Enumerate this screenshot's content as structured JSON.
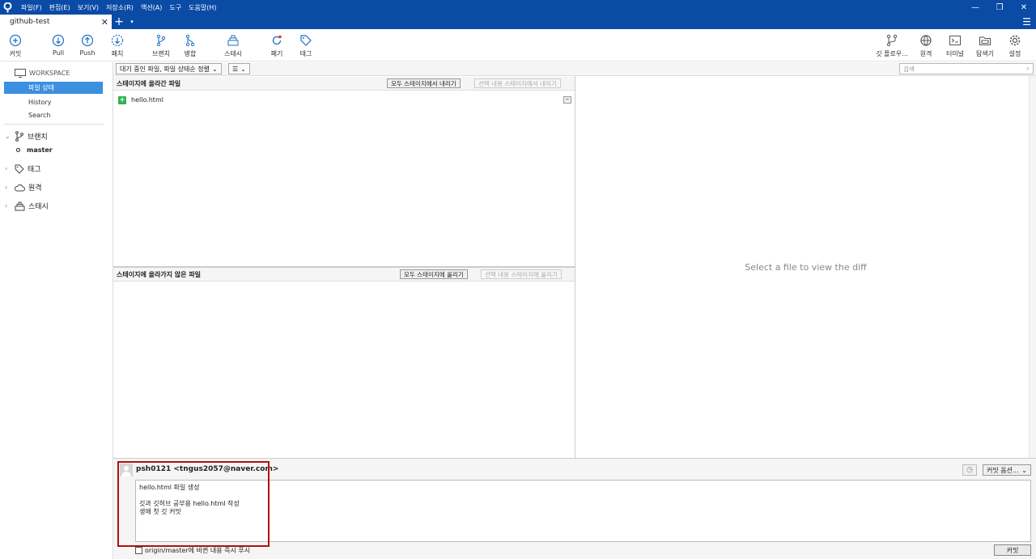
{
  "menu": [
    "파일(F)",
    "편집(E)",
    "보기(V)",
    "저장소(R)",
    "액션(A)",
    "도구",
    "도움말(H)"
  ],
  "window_controls": {
    "minimize": "—",
    "restore": "❐",
    "close": "✕"
  },
  "tab": {
    "title": "github-test",
    "close": "✕",
    "add": "+",
    "dropdown": "▾",
    "menu": "☰"
  },
  "toolbar": {
    "commit": "커밋",
    "pull": "Pull",
    "push": "Push",
    "fetch": "패치",
    "branch": "브랜치",
    "merge": "병합",
    "stash": "스태시",
    "discard": "폐기",
    "tag": "태그",
    "gitflow": "깃 플로우...",
    "remote": "원격",
    "terminal": "터미널",
    "explorer": "탐색기",
    "settings": "설정"
  },
  "filter": {
    "status_filter": "대기 중인 파일, 파일 상태순 정렬",
    "view_toggle": "☰",
    "search_placeholder": "검색",
    "search_icon": "⌕"
  },
  "sidebar": {
    "workspace": "WORKSPACE",
    "items": [
      "파일 상태",
      "History",
      "Search"
    ],
    "branches": "브랜치",
    "current_branch": "master",
    "tags": "태그",
    "remotes": "원격",
    "stashes": "스태시"
  },
  "staged": {
    "title": "스테이지에 올라간 파일",
    "unstage_all": "모두 스테이지에서 내리기",
    "unstage_selected": "선택 내용 스테이지에서 내리기",
    "files": [
      {
        "name": "hello.html",
        "status": "added"
      }
    ]
  },
  "unstaged": {
    "title": "스테이지에 올라가지 않은 파일",
    "stage_all": "모두 스테이지에 올리기",
    "stage_selected": "선택 내용 스테이지에 올리기"
  },
  "diff": {
    "placeholder": "Select a file to view the diff"
  },
  "commit": {
    "author": "psh0121 <tngus2057@naver.com>",
    "message": "hello.html 파일 생성\n\n깃과 깃허브 공부용 hello.html 작성\n생애 첫 깃 커밋",
    "options": "커밋 옵션...",
    "push_label": "origin/master에 바뀐 내용 즉시 푸시",
    "commit_button": "커밋"
  },
  "colors": {
    "titlebar": "#0a4ba6",
    "selected": "#3d8fe0",
    "added": "#2cb24a",
    "highlight": "#b21010"
  }
}
